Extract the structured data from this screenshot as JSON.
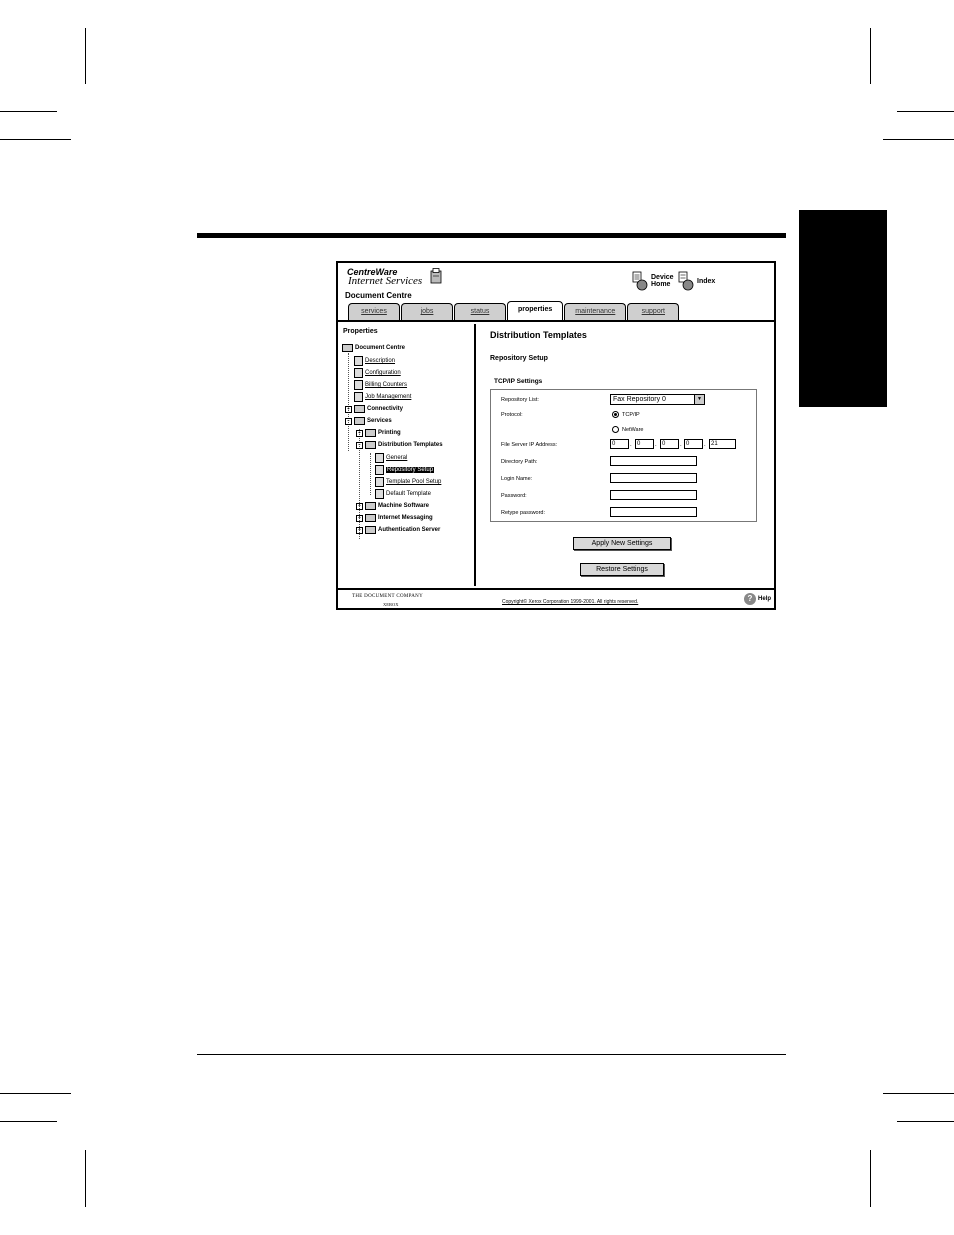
{
  "header": {
    "brand_line1": "CentreWare",
    "brand_line2": "Internet Services",
    "product": "Document Centre",
    "device_home_line1": "Device",
    "device_home_line2": "Home",
    "index_label": "Index"
  },
  "tabs": [
    {
      "label": "services",
      "active": false
    },
    {
      "label": "jobs",
      "active": false
    },
    {
      "label": "status",
      "active": false
    },
    {
      "label": "properties",
      "active": true
    },
    {
      "label": "maintenance",
      "active": false
    },
    {
      "label": "support",
      "active": false
    }
  ],
  "sidebar": {
    "title": "Properties",
    "items": [
      {
        "label": "Document Centre"
      },
      {
        "label": "Description"
      },
      {
        "label": "Configuration"
      },
      {
        "label": "Billing Counters"
      },
      {
        "label": "Job Management"
      },
      {
        "label": "Connectivity"
      },
      {
        "label": "Services"
      },
      {
        "label": "Printing"
      },
      {
        "label": "Distribution Templates"
      },
      {
        "label": "General"
      },
      {
        "label": "Repository Setup"
      },
      {
        "label": "Template Pool Setup"
      },
      {
        "label": "Default Template"
      },
      {
        "label": "Machine Software"
      },
      {
        "label": "Internet Messaging"
      },
      {
        "label": "Authentication Server"
      }
    ]
  },
  "main": {
    "title": "Distribution Templates",
    "subtitle": "Repository Setup",
    "section": "TCP/IP Settings",
    "repository_label": "Repository List:",
    "repository_value": "Fax Repository 0",
    "protocol_label": "Protocol:",
    "protocol_opt1": "TCP/IP",
    "protocol_opt2": "NetWare",
    "ip_label": "File Server IP Address:",
    "ip": [
      "0",
      "0",
      "0",
      "0",
      "21"
    ],
    "dir_label": "Directory Path:",
    "login_label": "Login Name:",
    "password_label": "Password:",
    "retype_label": "Retype password:",
    "apply_button": "Apply New Settings",
    "restore_button": "Restore Settings"
  },
  "footer": {
    "company": "THE DOCUMENT COMPANY",
    "xerox": "XEROX",
    "copyright": "Copyright© Xerox Corporation 1999-2001. All rights reserved.",
    "help": "Help"
  }
}
